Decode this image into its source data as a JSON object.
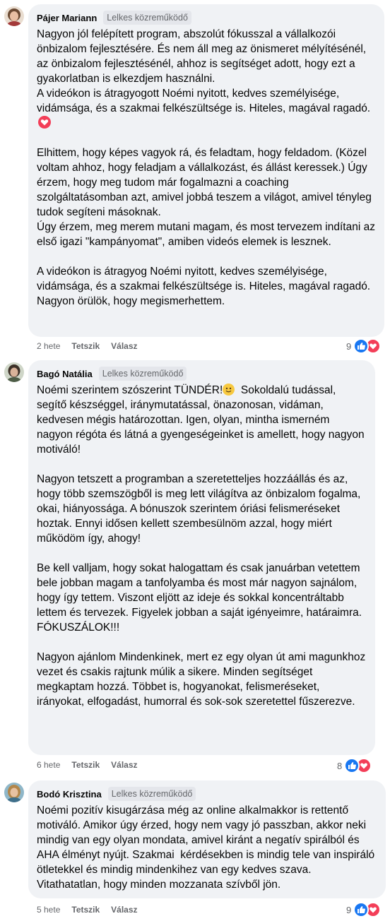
{
  "comments": [
    {
      "author": "Pájer Mariann",
      "badge": "Lelkes közreműködő",
      "text_p1": "Nagyon jól felépített program, abszolút fókusszal a vállalkozói önbizalom fejlesztésére. És nem áll meg az önismeret mélyítésénél, az önbizalom fejlesztésénél, ahhoz is segítséget adott, hogy ezt a gyakorlatban is elkezdjem használni.\nA videókon is átragyogott Noémi nyitott, kedves személyisége, vidámsága, és a szakmai felkészültsége is. Hiteles, magával ragadó.",
      "text_p2": "\n\nElhittem, hogy képes vagyok rá, és feladtam, hogy feldadom. (Közel voltam ahhoz, hogy feladjam a vállalkozást, és állást keressek.) Úgy érzem, hogy meg tudom már fogalmazni a coaching szolgáltatásomban azt, amivel jobbá teszem a világot, amivel tényleg tudok segíteni másoknak.\nÚgy érzem, meg merem mutani magam, és most tervezem indítani az első igazi \"kampányomat\", amiben videós elemek is lesznek.\n\nA videókon is átragyog Noémi nyitott, kedves személyisége, vidámsága, és a szakmai felkészültsége is. Hiteles, magával ragadó. Nagyon örülök, hogy megismerhettem.",
      "time": "2 hete",
      "like": "Tetszik",
      "reply": "Válasz",
      "reactions": "9"
    },
    {
      "author": "Bagó Natália",
      "badge": "Lelkes közreműködő",
      "text_p1": "Noémi szerintem szószerint TÜNDÉR!",
      "text_p2": "  Sokoldalú tudással, segítő készséggel, iránymutatással, önazonosan, vidáman, kedvesen mégis határozottan. Igen, olyan, mintha ismerném nagyon régóta és látná a gyengeségeinket is amellett, hogy nagyon motiváló!\n\nNagyon tetszett a programban a szeretetteljes hozzáállás és az, hogy több szemszögből is meg lett világítva az önbizalom fogalma, okai, hiányossága. A bónuszok szerintem óriási felismeréseket hoztak. Ennyi idősen kellett szembesülnöm azzal, hogy miért működöm így, ahogy!\n\nBe kell valljam, hogy sokat halogattam és csak januárban vetettem bele jobban magam a tanfolyamba és most már nagyon sajnálom, hogy így tettem. Viszont eljött az ideje és sokkal koncentráltabb lettem és tervezek. Figyelek jobban a saját igényeimre, határaimra.\nFÓKUSZÁLOK!!!\n\nNagyon ajánlom Mindenkinek, mert ez egy olyan út ami magunkhoz vezet és csakis rajtunk múlik a sikere. Minden segítséget megkaptam hozzá. Többet is, hogyanokat, felismeréseket, irányokat, elfogadást, humorral és sok-sok szeretettel fűszerezve.",
      "time": "6 hete",
      "like": "Tetszik",
      "reply": "Válasz",
      "reactions": "8"
    },
    {
      "author": "Bodó Krisztina",
      "badge": "Lelkes közreműködő",
      "text_p1": "Noémi pozitív kisugárzása még az online alkalmakkor is rettentő motiváló. Amikor úgy érzed, hogy nem vagy jó passzban, akkor neki mindig van egy olyan mondata, amivel kiránt a negatív spirálból és AHA élményt nyújt. Szakmai  kérdésekben is mindig tele van inspiráló ötletekkel és mindig mindenkihez van egy kedves szava. Vitathatatlan, hogy minden mozzanata szívből jön.",
      "time": "5 hete",
      "like": "Tetszik",
      "reply": "Válasz",
      "reactions": "9"
    }
  ],
  "colors": {
    "bubble": "#f0f2f5",
    "like_blue": "#1877f2",
    "love_red": "#f33e58",
    "meta_gray": "#65676b"
  },
  "icons": [
    "avatar",
    "heart-emoji-icon",
    "smiley-emoji-icon",
    "like-reaction-icon",
    "love-reaction-icon"
  ]
}
